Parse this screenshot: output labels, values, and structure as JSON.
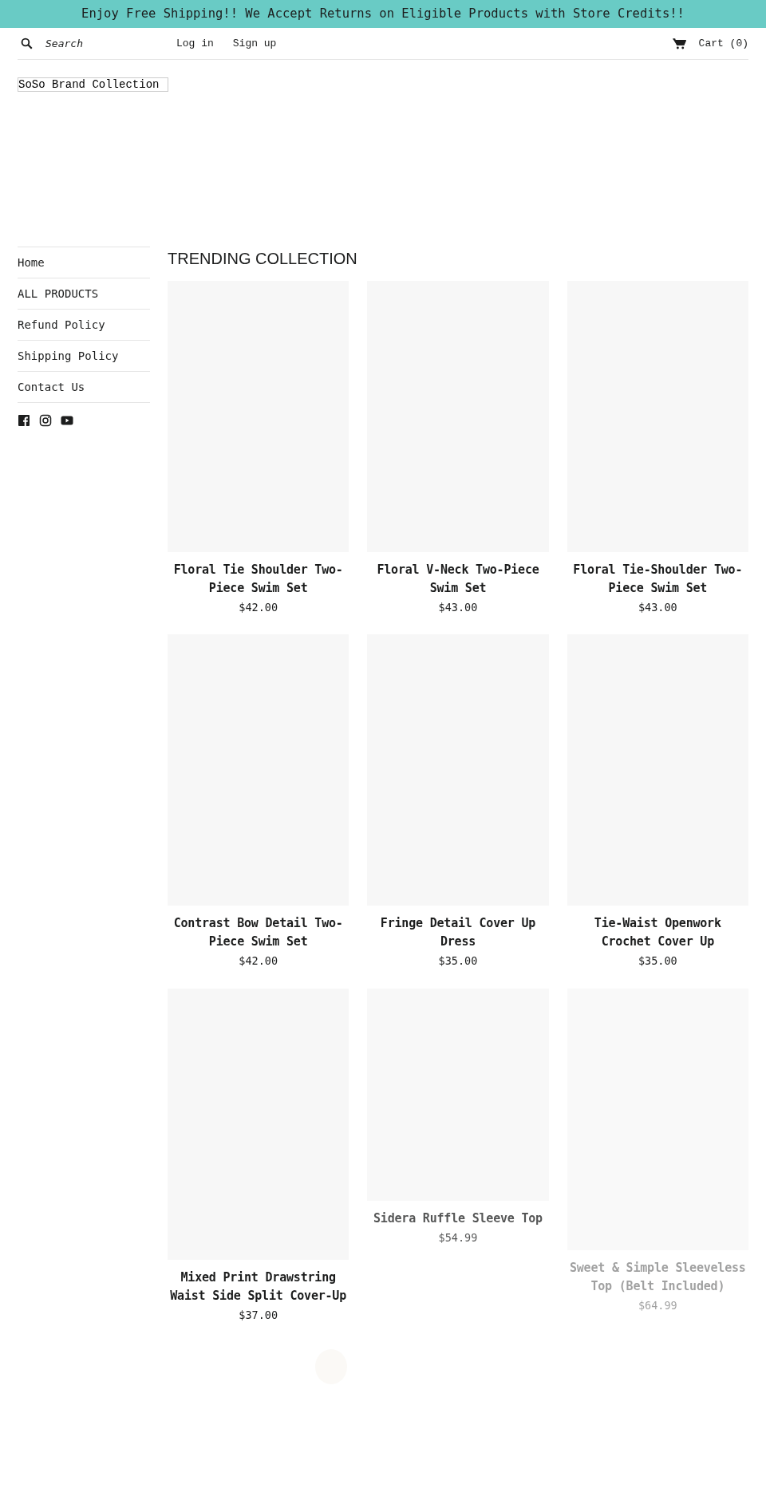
{
  "announcement": "Enjoy Free Shipping!! We Accept Returns on Eligible Products with Store Credits!!",
  "header": {
    "search": {
      "placeholder": "Search"
    },
    "links": [
      "Log in",
      "Sign up"
    ],
    "cart": "Cart (0)"
  },
  "logo": "SoSo Brand Collection",
  "sidebar": {
    "items": [
      "Home",
      "ALL PRODUCTS",
      "Refund Policy",
      "Shipping Policy",
      "Contact Us"
    ]
  },
  "collection": {
    "title": "TRENDING COLLECTION",
    "products": [
      {
        "name": "Floral Tie Shoulder Two-Piece Swim Set",
        "price": "$42.00",
        "kind": "shown"
      },
      {
        "name": "Floral V-Neck Two-Piece Swim Set",
        "price": "$43.00",
        "kind": "shown"
      },
      {
        "name": "Floral Tie-Shoulder Two-Piece Swim Set",
        "price": "$43.00",
        "kind": "shown"
      },
      {
        "name": "Contrast Bow Detail Two-Piece Swim Set",
        "price": "$42.00",
        "kind": "shown"
      },
      {
        "name": "Fringe Detail Cover Up Dress",
        "price": "$35.00",
        "kind": "shown"
      },
      {
        "name": "Tie-Waist Openwork Crochet Cover Up",
        "price": "$35.00",
        "kind": "shown"
      },
      {
        "name": "Mixed Print Drawstring Waist Side Split Cover-Up",
        "price": "$37.00",
        "kind": "shown"
      },
      {
        "name": "Sidera Ruffle Sleeve Top",
        "price": "$54.99",
        "kind": "fading"
      },
      {
        "name": "Sweet & Simple Sleeveless Top (Belt Included)",
        "price": "$64.99",
        "kind": "faint"
      }
    ]
  }
}
